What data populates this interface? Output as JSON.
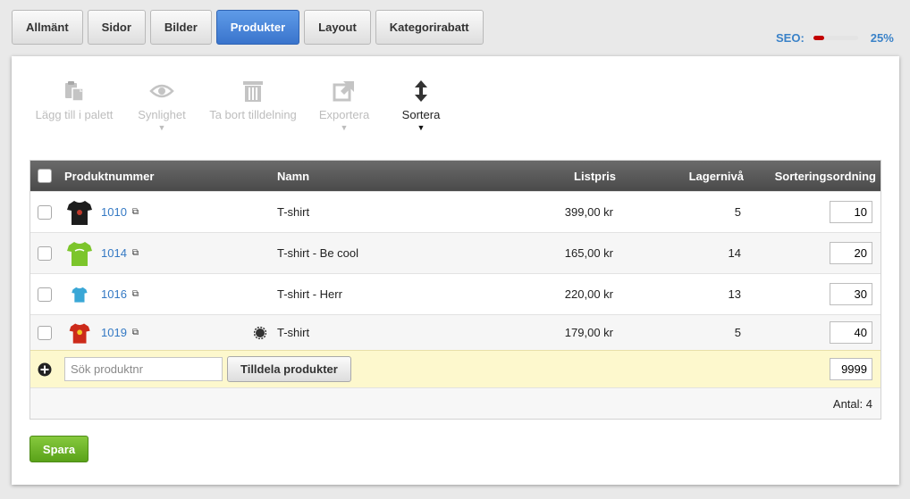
{
  "tabs": [
    {
      "label": "Allmänt",
      "active": false
    },
    {
      "label": "Sidor",
      "active": false
    },
    {
      "label": "Bilder",
      "active": false
    },
    {
      "label": "Produkter",
      "active": true
    },
    {
      "label": "Layout",
      "active": false
    },
    {
      "label": "Kategorirabatt",
      "active": false
    }
  ],
  "seo": {
    "label": "SEO:",
    "value": "25%",
    "fraction": 0.25,
    "bar_color": "#c20000"
  },
  "toolbar": {
    "add_to_palette": "Lägg till i palett",
    "visibility": "Synlighet",
    "remove_assignment": "Ta bort tilldelning",
    "export": "Exportera",
    "sort": "Sortera",
    "caret": "▼"
  },
  "table": {
    "headers": {
      "product_number": "Produktnummer",
      "name": "Namn",
      "list_price": "Listpris",
      "stock": "Lagernivå",
      "sort_order": "Sorteringsordning"
    },
    "rows": [
      {
        "number": "1010",
        "name": "T-shirt",
        "price": "399,00 kr",
        "stock": "5",
        "sort": "10",
        "color": "#1d1d1d"
      },
      {
        "number": "1014",
        "name": "T-shirt - Be cool",
        "price": "165,00 kr",
        "stock": "14",
        "sort": "20",
        "color": "#7cc52b"
      },
      {
        "number": "1016",
        "name": "T-shirt - Herr",
        "price": "220,00 kr",
        "stock": "13",
        "sort": "30",
        "color": "#3aa7d6"
      },
      {
        "number": "1019",
        "name": "T-shirt",
        "price": "179,00 kr",
        "stock": "5",
        "sort": "40",
        "color": "#cc2a1a"
      }
    ],
    "add_row": {
      "search_placeholder": "Sök produktnr",
      "assign_button": "Tilldela produkter",
      "sort_value": "9999"
    },
    "footer": {
      "count": "Antal: 4"
    }
  },
  "save_button": "Spara"
}
